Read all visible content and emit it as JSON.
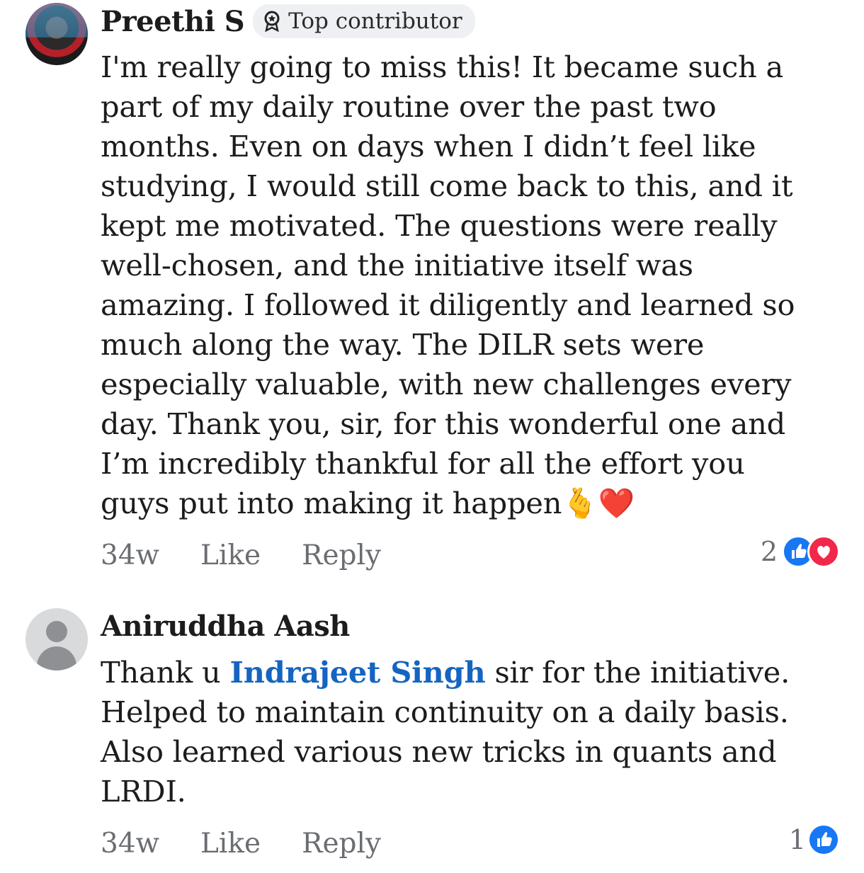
{
  "comments": [
    {
      "author": "Preethi S",
      "badge": "Top contributor",
      "text": "I'm really going to miss this! It became such a part of my daily routine over the past two months. Even on days when I didn’t feel like studying, I would still come back to this, and it kept me motivated. The questions were really well-chosen, and the initiative itself was amazing. I followed it diligently and learned so much along the way. The DILR sets were especially valuable, with new challenges every day. Thank you, sir, for this wonderful one and I’m incredibly thankful for all the effort you guys put into making it happen",
      "emojis": "🫰❤️",
      "time": "34w",
      "like_label": "Like",
      "reply_label": "Reply",
      "reaction_count": "2"
    },
    {
      "author": "Aniruddha Aash",
      "text_before": "Thank u ",
      "mention": "Indrajeet Singh",
      "text_after": " sir for the initiative. Helped to maintain continuity on a daily basis. Also learned various new tricks in quants and LRDI.",
      "time": "34w",
      "like_label": "Like",
      "reply_label": "Reply",
      "reaction_count": "1"
    }
  ],
  "icons": {
    "badge": "top-contributor-icon",
    "like": "like-reaction-icon",
    "love": "love-reaction-icon"
  },
  "colors": {
    "mention": "#1565c0",
    "like": "#1877f2",
    "love": "#f0284a"
  }
}
